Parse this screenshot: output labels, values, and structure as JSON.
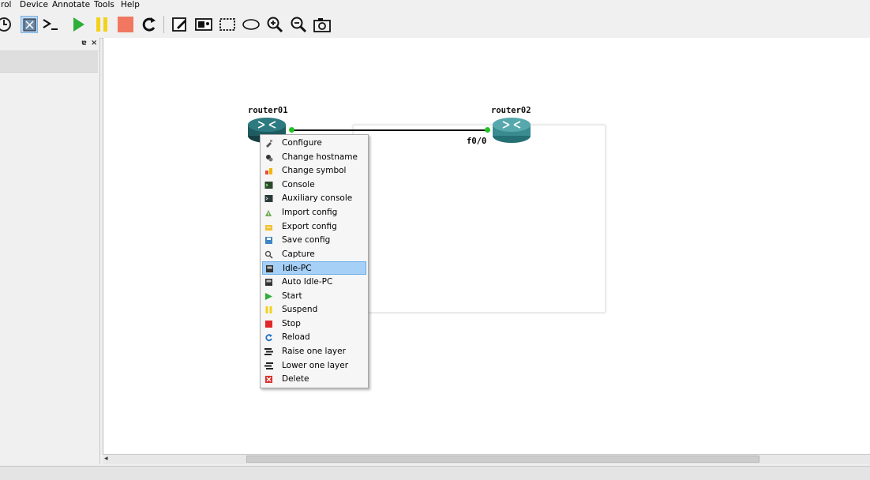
{
  "menubar": {
    "items": [
      "rol",
      "Device",
      "Annotate",
      "Tools",
      "Help"
    ]
  },
  "toolbar": {
    "buttons": [
      "snapshot-icon",
      "show-interface-labels-icon",
      "console-all-icon",
      "start-all-icon",
      "suspend-all-icon",
      "stop-all-icon",
      "reload-all-icon",
      "add-note-icon",
      "insert-picture-icon",
      "draw-rectangle-icon",
      "draw-ellipse-icon",
      "zoom-in-icon",
      "zoom-out-icon",
      "screenshot-icon"
    ]
  },
  "dock": {
    "float_btn": "ɐ",
    "close_btn": "×"
  },
  "topology": {
    "router1": {
      "label": "router01"
    },
    "router2": {
      "label": "router02"
    },
    "link": {
      "port_label": "f0/0"
    },
    "colors": {
      "router": "#1e5c60",
      "link_dot": "#21c321"
    }
  },
  "context_menu": {
    "items": [
      {
        "label": "Configure",
        "icon": "configure-icon"
      },
      {
        "label": "Change hostname",
        "icon": "change-hostname-icon"
      },
      {
        "label": "Change symbol",
        "icon": "change-symbol-icon"
      },
      {
        "label": "Console",
        "icon": "console-icon"
      },
      {
        "label": "Auxiliary console",
        "icon": "auxiliary-console-icon"
      },
      {
        "label": "Import config",
        "icon": "import-config-icon"
      },
      {
        "label": "Export config",
        "icon": "export-config-icon"
      },
      {
        "label": "Save config",
        "icon": "save-config-icon"
      },
      {
        "label": "Capture",
        "icon": "capture-icon"
      },
      {
        "label": "Idle-PC",
        "icon": "idle-pc-icon",
        "highlighted": true
      },
      {
        "label": "Auto Idle-PC",
        "icon": "auto-idle-pc-icon"
      },
      {
        "label": "Start",
        "icon": "start-icon"
      },
      {
        "label": "Suspend",
        "icon": "suspend-icon"
      },
      {
        "label": "Stop",
        "icon": "stop-icon"
      },
      {
        "label": "Reload",
        "icon": "reload-icon"
      },
      {
        "label": "Raise one layer",
        "icon": "raise-layer-icon"
      },
      {
        "label": "Lower one layer",
        "icon": "lower-layer-icon"
      },
      {
        "label": "Delete",
        "icon": "delete-icon"
      }
    ],
    "highlight_color": "#a6d0f5"
  },
  "scrollbar": {
    "left_arrow": "◂"
  }
}
